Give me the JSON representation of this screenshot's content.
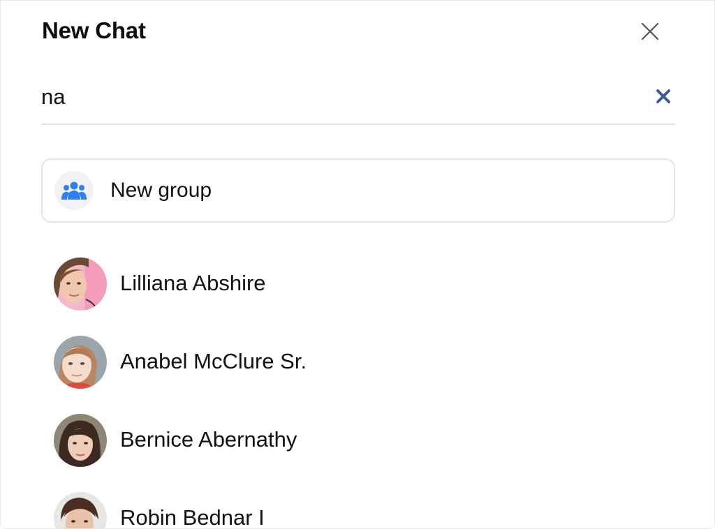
{
  "header": {
    "title": "New Chat",
    "close_icon": "close-icon"
  },
  "search": {
    "value": "na",
    "clear_icon": "clear-search-icon",
    "clear_color": "#3b5998"
  },
  "new_group": {
    "label": "New group",
    "icon": "people-group-icon",
    "icon_color": "#2f7ff0"
  },
  "contacts": [
    {
      "name": "Lilliana Abshire",
      "avatar": "avatar-photo"
    },
    {
      "name": "Anabel McClure Sr.",
      "avatar": "avatar-photo"
    },
    {
      "name": "Bernice Abernathy",
      "avatar": "avatar-photo"
    },
    {
      "name": "Robin Bednar I",
      "avatar": "avatar-photo"
    }
  ]
}
